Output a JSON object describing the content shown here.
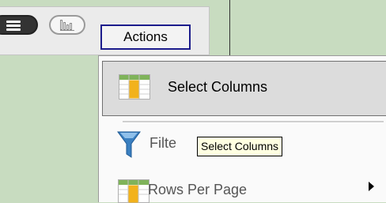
{
  "toolbar": {
    "list_view_icon": "list-view-icon",
    "chart_view_icon": "chart-view-icon",
    "actions_label": "Actions"
  },
  "menu": {
    "items": [
      {
        "label": "Select Columns",
        "icon": "select-columns-icon",
        "state": "hover"
      },
      {
        "label": "Filte",
        "icon": "filter-funnel-icon"
      },
      {
        "label": "Rows Per Page",
        "icon": "rows-per-page-icon",
        "has_submenu": true
      }
    ]
  },
  "tooltip": {
    "text": "Select Columns"
  },
  "colors": {
    "background": "#c8dcc0",
    "actions_border": "#1c1c8c",
    "funnel": "#3a7fc0",
    "grid_highlight": "#f2b21c"
  }
}
